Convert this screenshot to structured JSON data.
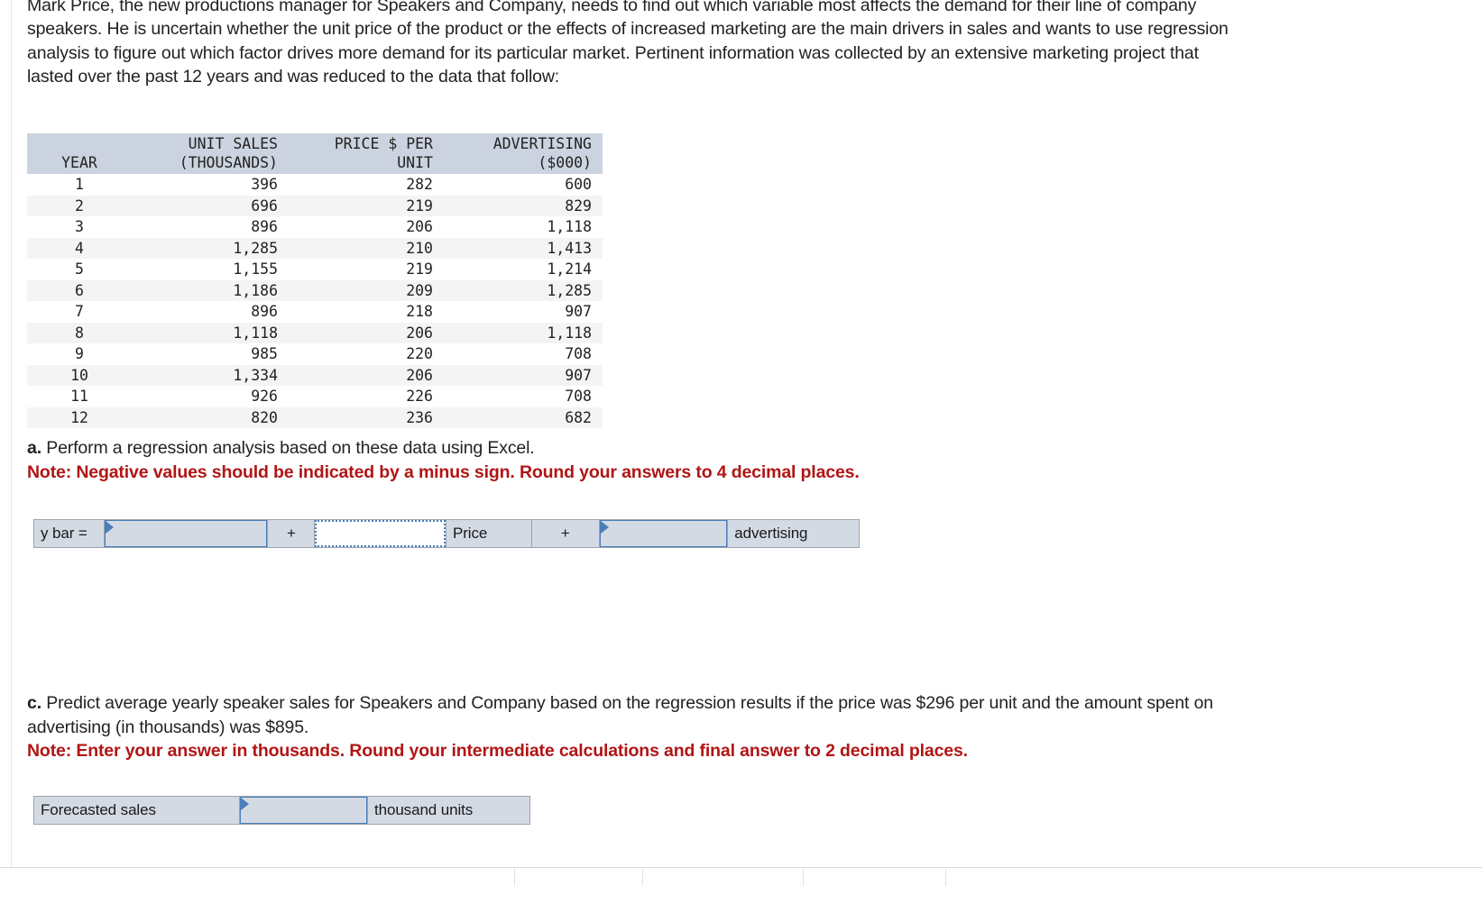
{
  "intro": {
    "paragraph": "Mark Price, the new productions manager for Speakers and Company, needs to find out which variable most affects the demand for their line of company speakers. He is uncertain whether the unit price of the product or the effects of increased marketing are the main drivers in sales and wants to use regression analysis to figure out which factor drives more demand for its particular market. Pertinent information was collected by an extensive marketing project that lasted over the past 12 years and was reduced to the data that follow:"
  },
  "data_table": {
    "headers": [
      {
        "line1": "",
        "line2": "YEAR"
      },
      {
        "line1": "UNIT SALES",
        "line2": "(THOUSANDS)"
      },
      {
        "line1": "PRICE $ PER",
        "line2": "UNIT"
      },
      {
        "line1": "ADVERTISING",
        "line2": "($000)"
      }
    ],
    "rows": [
      {
        "year": "1",
        "unit_sales": "396",
        "price": "282",
        "advertising": "600"
      },
      {
        "year": "2",
        "unit_sales": "696",
        "price": "219",
        "advertising": "829"
      },
      {
        "year": "3",
        "unit_sales": "896",
        "price": "206",
        "advertising": "1,118"
      },
      {
        "year": "4",
        "unit_sales": "1,285",
        "price": "210",
        "advertising": "1,413"
      },
      {
        "year": "5",
        "unit_sales": "1,155",
        "price": "219",
        "advertising": "1,214"
      },
      {
        "year": "6",
        "unit_sales": "1,186",
        "price": "209",
        "advertising": "1,285"
      },
      {
        "year": "7",
        "unit_sales": "896",
        "price": "218",
        "advertising": "907"
      },
      {
        "year": "8",
        "unit_sales": "1,118",
        "price": "206",
        "advertising": "1,118"
      },
      {
        "year": "9",
        "unit_sales": "985",
        "price": "220",
        "advertising": "708"
      },
      {
        "year": "10",
        "unit_sales": "1,334",
        "price": "206",
        "advertising": "907"
      },
      {
        "year": "11",
        "unit_sales": "926",
        "price": "226",
        "advertising": "708"
      },
      {
        "year": "12",
        "unit_sales": "820",
        "price": "236",
        "advertising": "682"
      }
    ]
  },
  "question_a": {
    "label": "a.",
    "text": " Perform a regression analysis based on these data using Excel.",
    "note": "Note: Negative values should be indicated by a minus sign. Round your answers to 4 decimal places."
  },
  "answer_a": {
    "y_bar_label": "y bar =",
    "intercept_value": "",
    "plus_1": "+",
    "price_coeff_value": "",
    "price_label": "Price",
    "plus_2": "+",
    "advertising_coeff_value": "",
    "advertising_label": "advertising"
  },
  "question_c": {
    "label": "c.",
    "text": " Predict average yearly speaker sales for Speakers and Company based on the regression results if the price was $296 per unit and the amount spent on advertising (in thousands) was $895.",
    "note": "Note: Enter your answer in thousands. Round your intermediate calculations and final answer to 2 decimal places."
  },
  "answer_c": {
    "forecast_label": "Forecasted sales",
    "forecast_value": "",
    "units_label": "thousand units"
  },
  "colors": {
    "note_red": "#b11515",
    "table_header_bg": "#ccd3e0",
    "widget_bg": "#d4dae4",
    "accent_blue": "#4a7ebb"
  }
}
